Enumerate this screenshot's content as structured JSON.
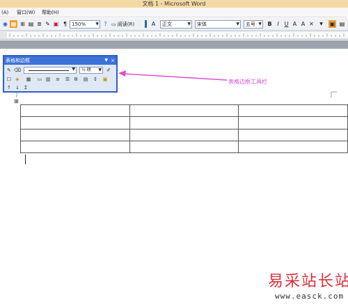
{
  "window": {
    "title": "文档 1 - Microsoft Word"
  },
  "menu": {
    "items": [
      "(A)",
      "窗口(W)",
      "帮助(H)"
    ]
  },
  "toolbar": {
    "zoom": "150%",
    "read_label": "阅读(R)",
    "style": "正文",
    "font": "宋体",
    "size": "五号",
    "bold": "B",
    "italic": "I",
    "underline": "U",
    "font_color_letter": "A"
  },
  "tables_borders_toolbar": {
    "title": "表格和边框",
    "line_weight": "½ 磅",
    "sum_symbol": "Σ"
  },
  "annotation": {
    "text": "表格边框工具栏"
  },
  "doc_table": {
    "rows": 4,
    "cols": 3,
    "cells": [
      [
        "",
        "",
        ""
      ],
      [
        "",
        "",
        ""
      ],
      [
        "",
        "",
        ""
      ],
      [
        "",
        "",
        ""
      ]
    ]
  },
  "watermark": {
    "brand": "易采站长站",
    "url": "www.easck.com"
  },
  "colors": {
    "annotation": "#d94fd6",
    "panel_border": "#2f5fc6",
    "watermark": "#d8303a"
  }
}
